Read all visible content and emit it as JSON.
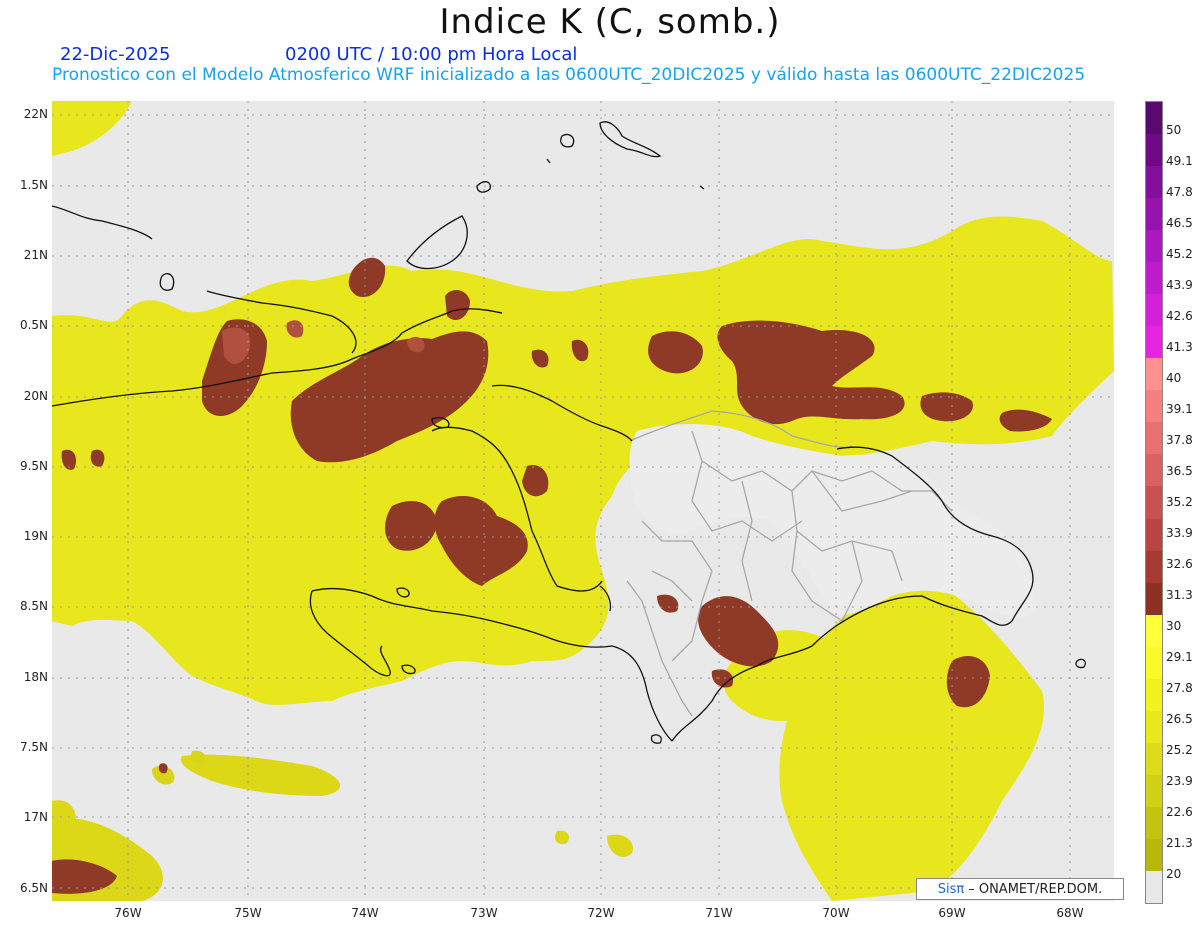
{
  "header": {
    "title": "Indice K (C, somb.)",
    "date": "22-Dic-2025",
    "time": "0200 UTC / 10:00 pm Hora Local",
    "description": "Pronostico con el Modelo Atmosferico WRF inicializado a las 0600UTC_20DIC2025 y válido hasta las  0600UTC_22DIC2025"
  },
  "map": {
    "lat_labels": [
      "22N",
      "1.5N",
      "21N",
      "0.5N",
      "20N",
      "9.5N",
      "19N",
      "8.5N",
      "18N",
      "7.5N",
      "17N",
      "6.5N"
    ],
    "lon_labels": [
      "76W",
      "75W",
      "74W",
      "73W",
      "72W",
      "71W",
      "70W",
      "69W",
      "68W"
    ],
    "lat_range": [
      16.4,
      22.1
    ],
    "lon_range": [
      -76.65,
      -67.6
    ],
    "grid": true
  },
  "colorbar": {
    "labels": [
      "50",
      "49.1",
      "47.8",
      "46.5",
      "45.2",
      "43.9",
      "42.6",
      "41.3",
      "40",
      "39.1",
      "37.8",
      "36.5",
      "35.2",
      "33.9",
      "32.6",
      "31.3",
      "30",
      "29.1",
      "27.8",
      "26.5",
      "25.2",
      "23.9",
      "22.6",
      "21.3",
      "20"
    ],
    "colors": [
      "#5a0a6e",
      "#6e0a84",
      "#82109a",
      "#9614ae",
      "#ac18c0",
      "#c01ccc",
      "#d420d8",
      "#e424e0",
      "#ff9090",
      "#f48080",
      "#e87070",
      "#d86262",
      "#c85252",
      "#b84444",
      "#a43a30",
      "#8b3220",
      "#ffff3a",
      "#fafa2a",
      "#f2f220",
      "#e8e81c",
      "#dcdc18",
      "#d0d014",
      "#c4c410",
      "#b8b80c",
      "#e8e8e8"
    ]
  },
  "footer": {
    "credit_logo": "Sisπ",
    "credit_text": "– ONAMET/REP.DOM."
  },
  "colors": {
    "background": "#e9e9e9",
    "yellow_fill": "#f0ee1a",
    "yellow_dark": "#d4d020",
    "brown_fill": "#8e3a26",
    "salmon": "#c86050",
    "coast": "#111111",
    "border": "#aaaaaa"
  }
}
